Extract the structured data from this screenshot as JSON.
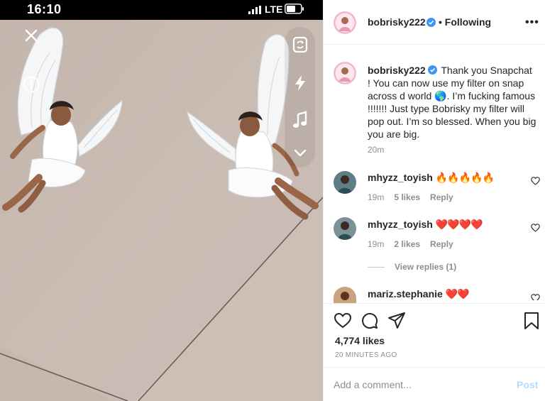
{
  "phone": {
    "status": {
      "time": "16:10",
      "network": "LTE"
    },
    "icons": {
      "close": "close-x-icon",
      "info": "info-icon",
      "flip_camera": "camera-flip-icon",
      "flash": "flash-icon",
      "music": "music-note-icon",
      "more": "chevron-down-icon"
    },
    "filter": "angel-filter",
    "colors": {
      "ceiling": "#c8bab1"
    }
  },
  "post": {
    "header": {
      "username": "bobrisky222",
      "following_label": "• Following",
      "more_label": "•••"
    },
    "caption": {
      "username": "bobrisky222",
      "text_part1": "Thank you Snapchat ! You can now use my filter on snap across d world",
      "globe": "🌎",
      "text_part2": ". I’m fucking famous !!!!!!! Just type Bobrisky my filter will pop out. I’m so blessed. When you big you are big.",
      "time": "20m"
    },
    "comments": [
      {
        "username": "mhyzz_toyish",
        "text": "🔥🔥🔥🔥🔥",
        "time": "19m",
        "likes": "5 likes",
        "reply": "Reply"
      },
      {
        "username": "mhyzz_toyish",
        "text": "❤️❤️❤️❤️",
        "time": "19m",
        "likes": "2 likes",
        "reply": "Reply"
      },
      {
        "username": "mariz.stephanie",
        "text": "❤️❤️"
      }
    ],
    "view_replies": "View replies (1)",
    "actions": {
      "icons": [
        "heart-icon",
        "comment-icon",
        "share-icon",
        "bookmark-icon"
      ]
    },
    "likes": "4,774 likes",
    "posted": "20 MINUTES AGO",
    "comment_box": {
      "placeholder": "Add a comment...",
      "post_label": "Post"
    },
    "colors": {
      "verified": "#3897f0",
      "text": "#262626",
      "muted": "#8e8e8e",
      "post_disabled": "#b3dbff"
    }
  }
}
